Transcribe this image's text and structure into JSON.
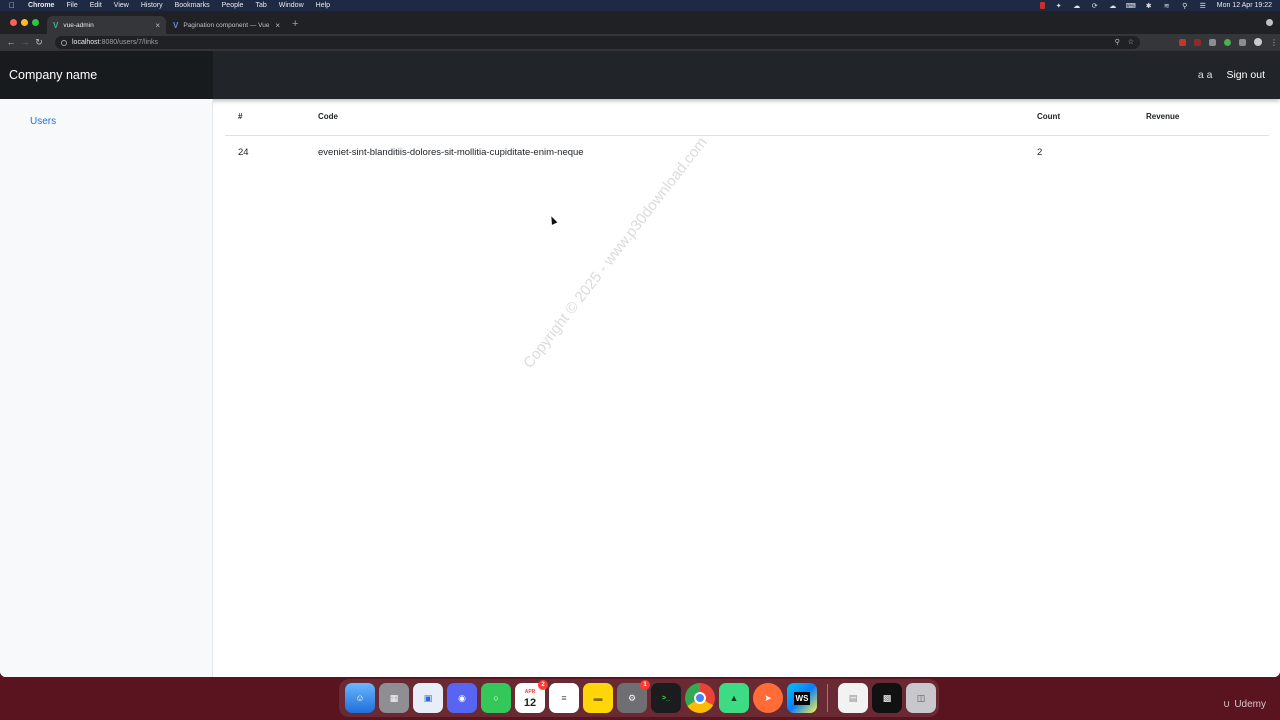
{
  "menubar": {
    "app": "Chrome",
    "items": [
      "File",
      "Edit",
      "View",
      "History",
      "Bookmarks",
      "People",
      "Tab",
      "Window",
      "Help"
    ],
    "clock": "Mon 12 Apr 19:22"
  },
  "browser": {
    "tabs": [
      {
        "title": "vue-admin",
        "active": true,
        "icon": "vue-favicon-icon"
      },
      {
        "title": "Pagination component — Vue",
        "active": false,
        "icon": "vuetify-favicon-icon"
      }
    ],
    "url_host": "localhost",
    "url_path": ":8080/users/7/links"
  },
  "app": {
    "brand": "Company name",
    "user": "a a",
    "sign_out": "Sign out",
    "sidebar": {
      "items": [
        {
          "label": "Users"
        }
      ]
    },
    "table": {
      "headers": [
        "#",
        "Code",
        "Count",
        "Revenue"
      ],
      "rows": [
        {
          "id": "24",
          "code": "eveniet-sint-blanditiis-dolores-sit-mollitia-cupiditate-enim-neque",
          "count": "2",
          "revenue": ""
        }
      ]
    }
  },
  "watermark": "Copyright © 2025 - www.p30download.com",
  "dock": {
    "apps": [
      "Finder",
      "Launchpad",
      "Keynote",
      "Discord",
      "Messages",
      "Calendar",
      "Reminders",
      "Notes",
      "System Preferences",
      "Terminal",
      "Chrome",
      "Android Studio",
      "Postman",
      "WebStorm",
      "Preview",
      "Terminal window",
      "Trash"
    ],
    "calendar_month": "APR",
    "calendar_day": "12",
    "calendar_badge": "2",
    "prefs_badge": "1"
  },
  "udemy_logo": "Udemy",
  "colors": {
    "navbar": "#212529",
    "link": "#2470dc",
    "sidebar": "#f8f9fa"
  }
}
